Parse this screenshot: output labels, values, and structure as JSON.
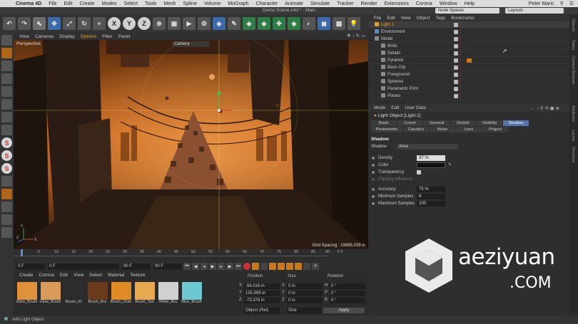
{
  "menubar": {
    "app": "Cinema 4D",
    "items": [
      "File",
      "Edit",
      "Create",
      "Modes",
      "Select",
      "Tools",
      "Mesh",
      "Spline",
      "Volume",
      "MoGraph",
      "Character",
      "Animate",
      "Simulate",
      "Tracker",
      "Render",
      "Extensions",
      "Corona",
      "Window",
      "Help"
    ],
    "user": "Peter Maric"
  },
  "window": {
    "title": "Demo Scene.c4d * - Main",
    "node_spaces": "Node Spaces",
    "layouts": "Layouts"
  },
  "viewport": {
    "menu": [
      "View",
      "Cameras",
      "Display",
      "Options",
      "Filter",
      "Panel"
    ],
    "label": "Perspective",
    "camera": "Camera",
    "grid_spacing": "Grid Spacing : 19685.039 in"
  },
  "timeline": {
    "ticks": [
      "0",
      "5",
      "10",
      "15",
      "20",
      "25",
      "30",
      "35",
      "40",
      "45",
      "50",
      "55",
      "60",
      "65",
      "70",
      "75",
      "80",
      "85",
      "90"
    ],
    "end_frame": "0 F",
    "current_frame": "0 F",
    "start_field": "0 F",
    "end_field": "90 F",
    "max_field": "90 F"
  },
  "material_manager": {
    "menu": [
      "Create",
      "Corona",
      "Edit",
      "View",
      "Select",
      "Material",
      "Texture"
    ],
    "materials": [
      {
        "name": "Glow_Brush",
        "color": "#e0913c"
      },
      {
        "name": "Glow_Brush",
        "color": "#d99a5a"
      },
      {
        "name": "Brush_01",
        "color": "#2c2c2c"
      },
      {
        "name": "Brush_Bro",
        "color": "#6b3a1c"
      },
      {
        "name": "Brush_Oran",
        "color": "#e08a25"
      },
      {
        "name": "Brush_Tan",
        "color": "#e8a850"
      },
      {
        "name": "White_Bru",
        "color": "#d0d0d0"
      },
      {
        "name": "Blue_Brush",
        "color": "#6cc9d4"
      }
    ]
  },
  "coordinates": {
    "headers": {
      "position": "Position",
      "size": "Size",
      "rotation": "Rotation"
    },
    "rows": [
      {
        "axis": "X",
        "position": "-56.016 in",
        "size_axis": "X",
        "size": "0 in",
        "rot_axis": "H",
        "rotation": "0 °"
      },
      {
        "axis": "Y",
        "position": "155.995 in",
        "size_axis": "Y",
        "size": "0 in",
        "rot_axis": "P",
        "rotation": "0 °"
      },
      {
        "axis": "Z",
        "position": "-73.378 in",
        "size_axis": "Z",
        "size": "0 in",
        "rot_axis": "B",
        "rotation": "0 °"
      }
    ],
    "mode": "Object (Rel)",
    "size_mode": "Size",
    "apply": "Apply"
  },
  "status": {
    "text": "Add Light Object"
  },
  "object_manager": {
    "menu": [
      "File",
      "Edit",
      "View",
      "Object",
      "Tags",
      "Bookmarks"
    ],
    "objects": [
      {
        "name": "Light.1",
        "indent": 1,
        "icon": "#e0a030",
        "selected": true,
        "tag": false,
        "name_color": "#e8a030"
      },
      {
        "name": "Environment",
        "indent": 1,
        "icon": "#5a8ac6",
        "selected": false,
        "tag": false,
        "name_color": "#cccccc"
      },
      {
        "name": "Model",
        "indent": 1,
        "icon": "#8a8a8a",
        "selected": false,
        "tag": false,
        "name_color": "#cccccc"
      },
      {
        "name": "Birds",
        "indent": 2,
        "icon": "#8a8a8a",
        "selected": false,
        "tag": false,
        "name_color": "#cccccc"
      },
      {
        "name": "Details",
        "indent": 2,
        "icon": "#8a8a8a",
        "selected": false,
        "tag": false,
        "name_color": "#cccccc"
      },
      {
        "name": "Pyramid",
        "indent": 2,
        "icon": "#8a8a8a",
        "selected": false,
        "tag": true,
        "name_color": "#cccccc"
      },
      {
        "name": "Back City",
        "indent": 2,
        "icon": "#8a8a8a",
        "selected": false,
        "tag": false,
        "name_color": "#cccccc"
      },
      {
        "name": "Foreground",
        "indent": 2,
        "icon": "#8a8a8a",
        "selected": false,
        "tag": false,
        "name_color": "#cccccc"
      },
      {
        "name": "Spheres",
        "indent": 2,
        "icon": "#8a8a8a",
        "selected": false,
        "tag": false,
        "name_color": "#cccccc"
      },
      {
        "name": "Parametric Prim",
        "indent": 2,
        "icon": "#8a8a8a",
        "selected": false,
        "tag": false,
        "name_color": "#cccccc"
      },
      {
        "name": "Planes",
        "indent": 2,
        "icon": "#8a8a8a",
        "selected": false,
        "tag": false,
        "name_color": "#cccccc"
      }
    ]
  },
  "attribute_manager": {
    "menu": [
      "Mode",
      "Edit",
      "User Data"
    ],
    "title": "Light Object [Light.1]",
    "tabs": [
      "Basic",
      "Coord.",
      "General",
      "Details",
      "Visibility",
      "Shadow",
      "Photometric",
      "Caustics",
      "Noise",
      "Lens",
      "Project"
    ],
    "active_tab": "Shadow",
    "section": "Shadow",
    "shadow_label": "Shadow",
    "shadow_value": "Area",
    "density_label": "Density",
    "density_value": "87 %",
    "color_label": "Color",
    "transparency_label": "Transparency",
    "clipping_label": "Clipping Influence",
    "accuracy_label": "Accuracy",
    "accuracy_value": "75 %",
    "min_samples_label": "Minimum Samples",
    "min_samples_value": "8",
    "max_samples_label": "Maximum Samples",
    "max_samples_value": "100"
  },
  "side_tabs": [
    "Objects",
    "Takes",
    "Content Browser",
    "Attributes",
    "Layers",
    "Structure"
  ],
  "watermark": {
    "main": "aeziyuan",
    "sub": ".COM"
  }
}
